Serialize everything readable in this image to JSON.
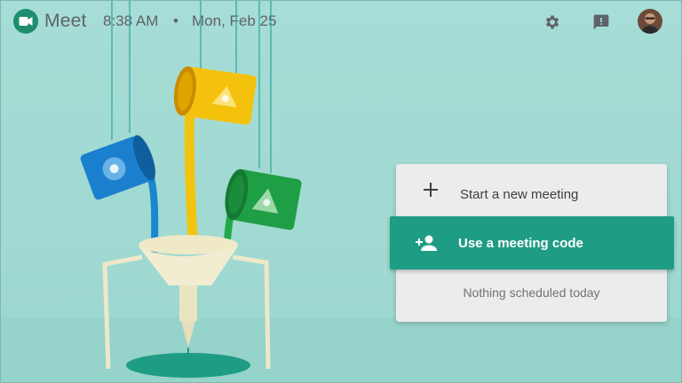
{
  "header": {
    "app_name": "Meet",
    "time": "8:38 AM",
    "separator": "•",
    "date": "Mon, Feb 25",
    "icons": [
      "settings-icon",
      "feedback-icon",
      "avatar"
    ]
  },
  "card": {
    "start_label": "Start a new meeting",
    "code_label": "Use a meeting code",
    "empty_message": "Nothing scheduled today"
  },
  "colors": {
    "accent": "#1f9c84",
    "background": "#a6ddd6",
    "card": "#ececec",
    "text": "#5f6368"
  }
}
